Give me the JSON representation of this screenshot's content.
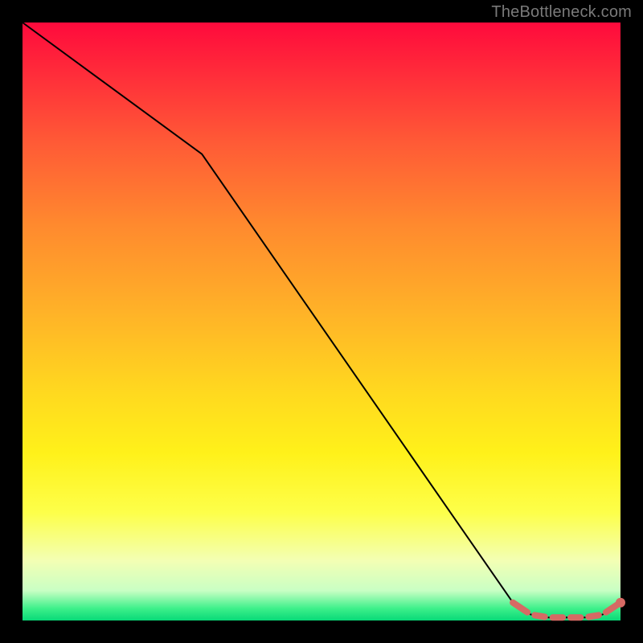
{
  "watermark": "TheBottleneck.com",
  "chart_data": {
    "type": "line",
    "title": "",
    "xlabel": "",
    "ylabel": "",
    "xlim": [
      0,
      100
    ],
    "ylim": [
      0,
      100
    ],
    "series": [
      {
        "name": "main-curve",
        "x": [
          0,
          30,
          82,
          85,
          88,
          91,
          94,
          97,
          100
        ],
        "values": [
          100,
          78,
          3,
          1,
          0.5,
          0.5,
          0.5,
          1,
          3
        ]
      },
      {
        "name": "highlight-dash",
        "x": [
          82,
          85,
          88,
          91,
          94,
          97,
          100
        ],
        "values": [
          3,
          1,
          0.5,
          0.5,
          0.5,
          1,
          3
        ]
      }
    ],
    "gradient_stops": [
      {
        "pct": 0,
        "color": "#ff0a3c"
      },
      {
        "pct": 20,
        "color": "#ff5a36"
      },
      {
        "pct": 48,
        "color": "#ffb128"
      },
      {
        "pct": 72,
        "color": "#fff11a"
      },
      {
        "pct": 95,
        "color": "#c9ffc4"
      },
      {
        "pct": 100,
        "color": "#08d978"
      }
    ],
    "dash_color": "#d66a64",
    "line_color": "#000000"
  }
}
